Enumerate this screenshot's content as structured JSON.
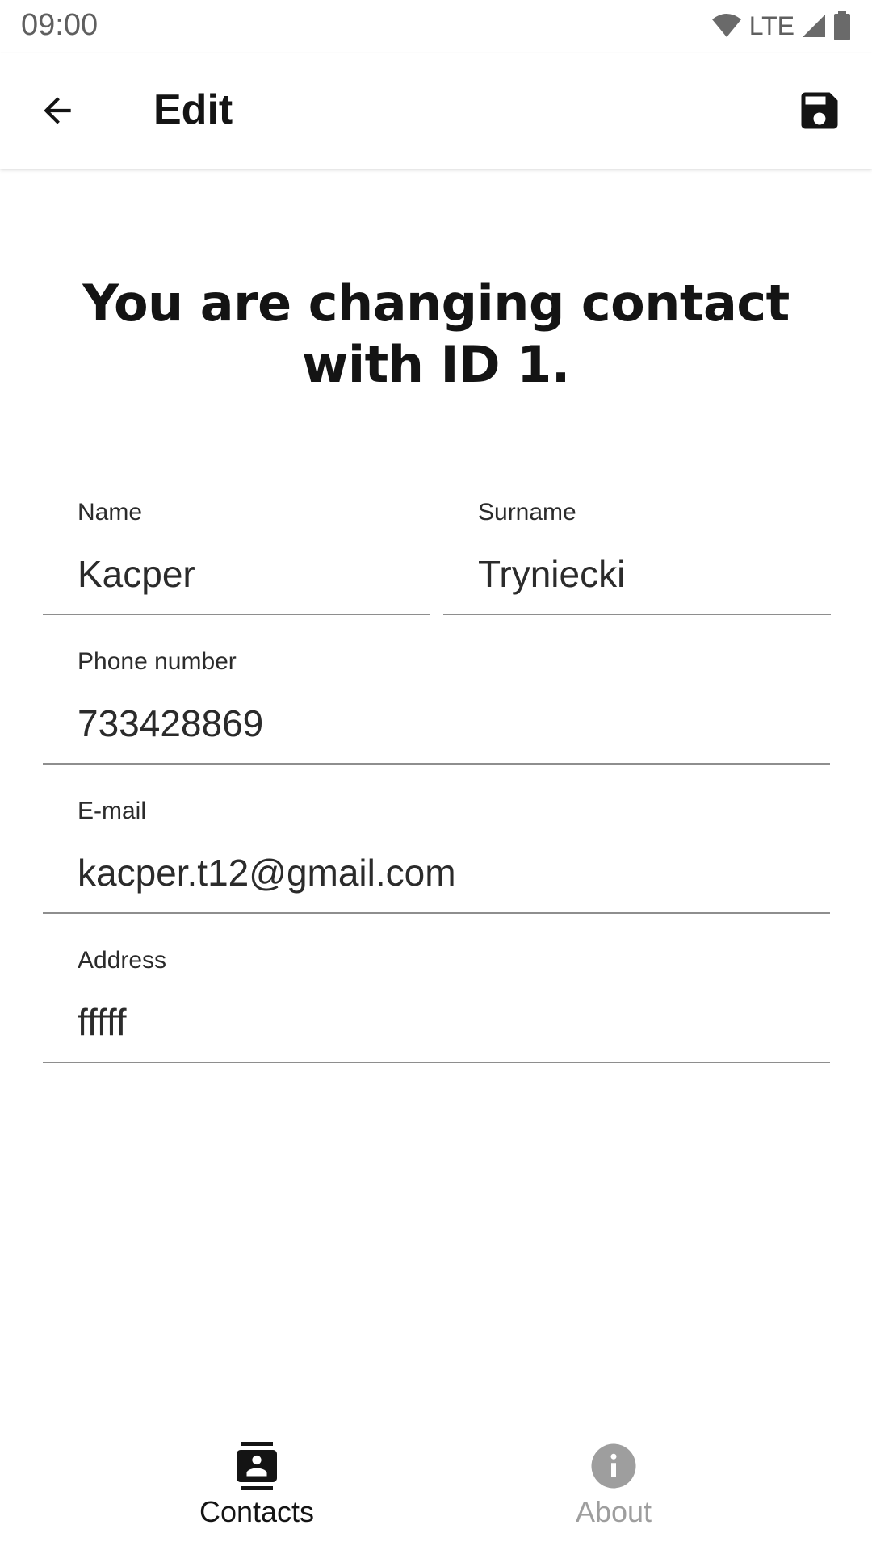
{
  "status_bar": {
    "time": "09:00",
    "network": "LTE"
  },
  "app_bar": {
    "title": "Edit",
    "back_icon": "arrow-left-icon",
    "save_icon": "floppy-disk-icon"
  },
  "heading": {
    "line1": "You are changing contact",
    "line2": "with ID 1."
  },
  "form": {
    "name": {
      "label": "Name",
      "value": "Kacper"
    },
    "surname": {
      "label": "Surname",
      "value": "Tryniecki"
    },
    "phone": {
      "label": "Phone number",
      "value": "733428869"
    },
    "email": {
      "label": "E-mail",
      "value": "kacper.t12@gmail.com"
    },
    "address": {
      "label": "Address",
      "value": "fffff"
    }
  },
  "bottom_nav": {
    "items": [
      {
        "label": "Contacts",
        "icon": "contacts-icon",
        "active": true
      },
      {
        "label": "About",
        "icon": "info-icon",
        "active": false
      }
    ]
  },
  "colors": {
    "active": "#141414",
    "inactive": "#9e9e9e",
    "underline": "#8e8e8e"
  }
}
